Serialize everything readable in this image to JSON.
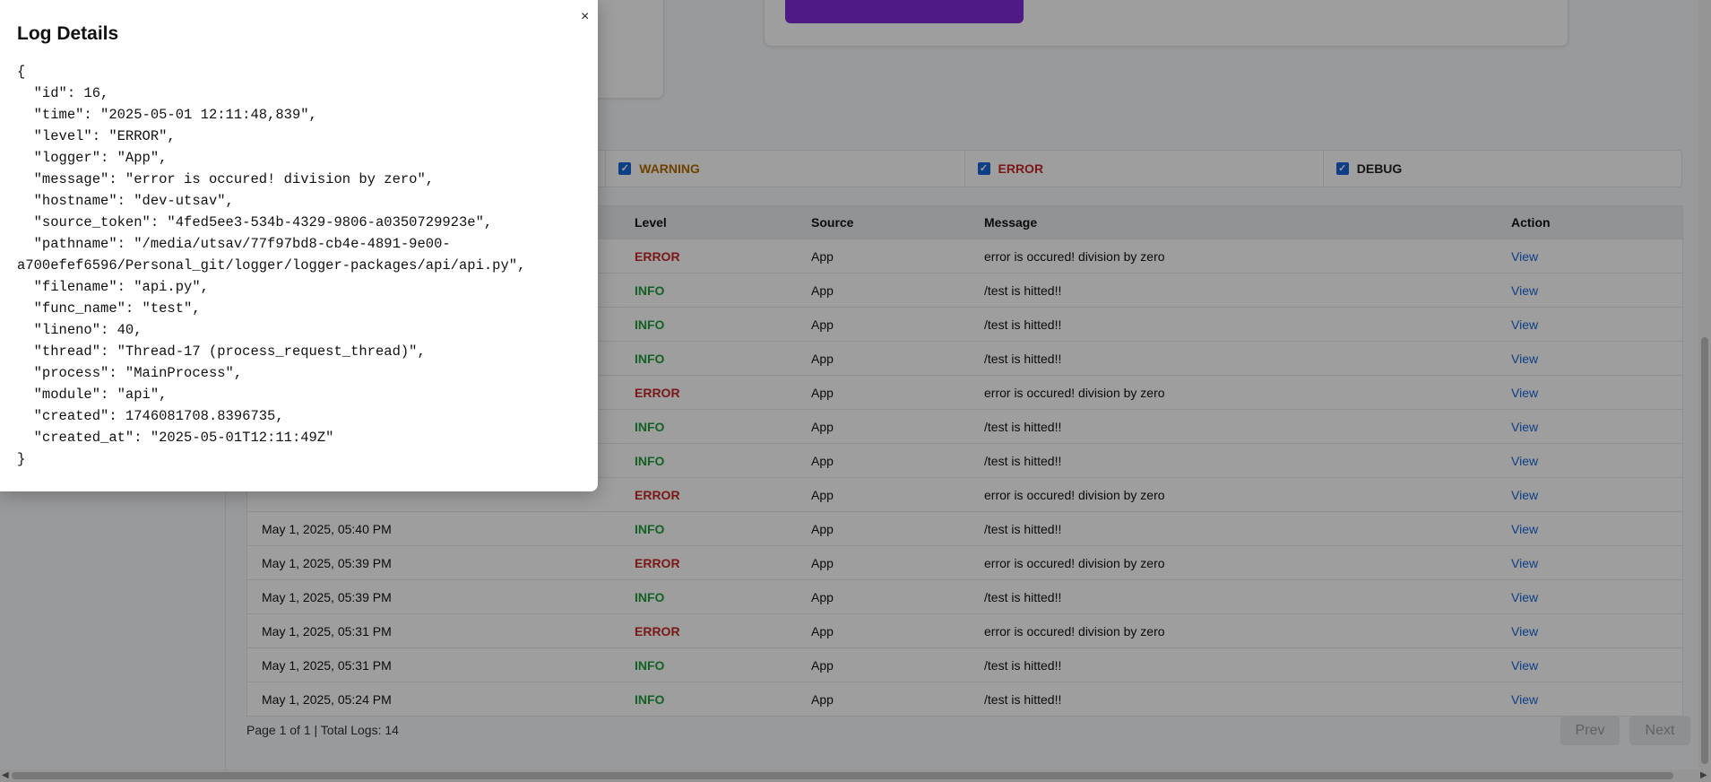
{
  "filters": [
    {
      "label": "WARNING",
      "color": "#b26a00"
    },
    {
      "label": "ERROR",
      "color": "#c62828"
    },
    {
      "label": "DEBUG",
      "color": "#222222"
    }
  ],
  "table": {
    "headers": {
      "level": "Level",
      "source": "Source",
      "message": "Message",
      "action": "Action"
    },
    "rows": [
      {
        "time": "",
        "level": "ERROR",
        "source": "App",
        "message": "error is occured! division by zero",
        "action": "View"
      },
      {
        "time": "",
        "level": "INFO",
        "source": "App",
        "message": "/test is hitted!!",
        "action": "View"
      },
      {
        "time": "",
        "level": "INFO",
        "source": "App",
        "message": "/test is hitted!!",
        "action": "View"
      },
      {
        "time": "",
        "level": "INFO",
        "source": "App",
        "message": "/test is hitted!!",
        "action": "View"
      },
      {
        "time": "",
        "level": "ERROR",
        "source": "App",
        "message": "error is occured! division by zero",
        "action": "View"
      },
      {
        "time": "",
        "level": "INFO",
        "source": "App",
        "message": "/test is hitted!!",
        "action": "View"
      },
      {
        "time": "",
        "level": "INFO",
        "source": "App",
        "message": "/test is hitted!!",
        "action": "View"
      },
      {
        "time": "",
        "level": "ERROR",
        "source": "App",
        "message": "error is occured! division by zero",
        "action": "View"
      },
      {
        "time": "May 1, 2025, 05:40 PM",
        "level": "INFO",
        "source": "App",
        "message": "/test is hitted!!",
        "action": "View"
      },
      {
        "time": "May 1, 2025, 05:39 PM",
        "level": "ERROR",
        "source": "App",
        "message": "error is occured! division by zero",
        "action": "View"
      },
      {
        "time": "May 1, 2025, 05:39 PM",
        "level": "INFO",
        "source": "App",
        "message": "/test is hitted!!",
        "action": "View"
      },
      {
        "time": "May 1, 2025, 05:31 PM",
        "level": "ERROR",
        "source": "App",
        "message": "error is occured! division by zero",
        "action": "View"
      },
      {
        "time": "May 1, 2025, 05:31 PM",
        "level": "INFO",
        "source": "App",
        "message": "/test is hitted!!",
        "action": "View"
      },
      {
        "time": "May 1, 2025, 05:24 PM",
        "level": "INFO",
        "source": "App",
        "message": "/test is hitted!!",
        "action": "View"
      }
    ]
  },
  "pagination": {
    "info": "Page 1 of 1 | Total Logs: 14",
    "prev": "Prev",
    "next": "Next"
  },
  "modal": {
    "title": "Log Details",
    "close": "×",
    "json_text": "{\n  \"id\": 16,\n  \"time\": \"2025-05-01 12:11:48,839\",\n  \"level\": \"ERROR\",\n  \"logger\": \"App\",\n  \"message\": \"error is occured! division by zero\",\n  \"hostname\": \"dev-utsav\",\n  \"source_token\": \"4fed5ee3-534b-4329-9806-a0350729923e\",\n  \"pathname\": \"/media/utsav/77f97bd8-cb4e-4891-9e00-\na700efef6596/Personal_git/logger/logger-packages/api/api.py\",\n  \"filename\": \"api.py\",\n  \"func_name\": \"test\",\n  \"lineno\": 40,\n  \"thread\": \"Thread-17 (process_request_thread)\",\n  \"process\": \"MainProcess\",\n  \"module\": \"api\",\n  \"created\": 1746081708.8396735,\n  \"created_at\": \"2025-05-01T12:11:49Z\"\n}"
  },
  "colors": {
    "accent_purple": "#7c2bd9",
    "link_blue": "#1565d8",
    "error_red": "#c62828",
    "info_green": "#1f9d3a",
    "warning_orange": "#b26a00"
  }
}
